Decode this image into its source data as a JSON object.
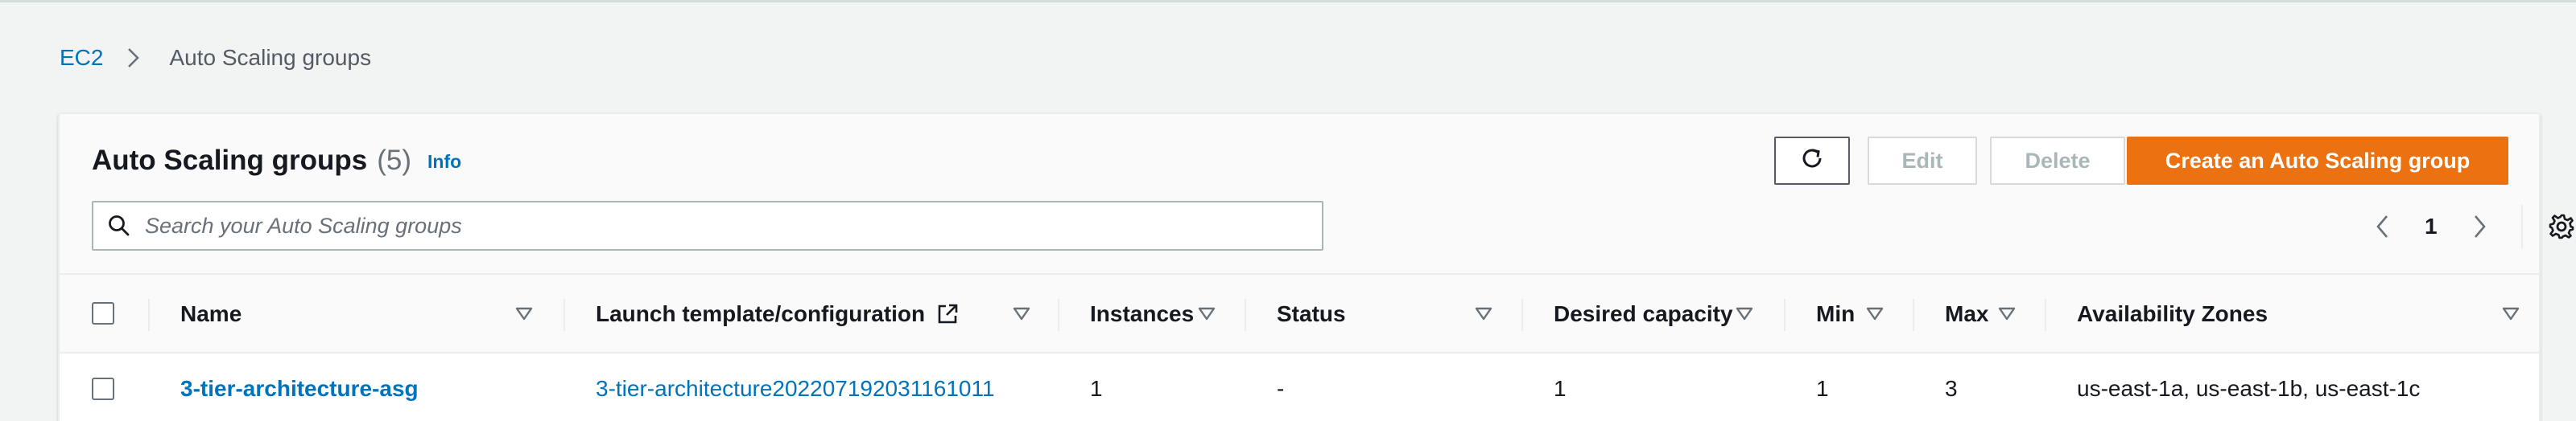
{
  "breadcrumb": {
    "root": "EC2",
    "current": "Auto Scaling groups"
  },
  "header": {
    "title": "Auto Scaling groups",
    "count": "(5)",
    "info": "Info"
  },
  "actions": {
    "refresh_icon": "refresh-icon",
    "edit": "Edit",
    "delete": "Delete",
    "create": "Create an Auto Scaling group"
  },
  "search": {
    "placeholder": "Search your Auto Scaling groups",
    "value": ""
  },
  "pagination": {
    "current_page": "1"
  },
  "table": {
    "columns": [
      "Name",
      "Launch template/configuration",
      "Instances",
      "Status",
      "Desired capacity",
      "Min",
      "Max",
      "Availability Zones"
    ],
    "rows": [
      {
        "name": "3-tier-architecture-asg",
        "launch_template": "3-tier-architecture20220719203116​1011",
        "instances": "1",
        "status": "-",
        "desired_capacity": "1",
        "min": "1",
        "max": "3",
        "availability_zones": "us-east-1a, us-east-1b, us-east-1c"
      }
    ]
  },
  "colors": {
    "link": "#0073bb",
    "primary_button": "#ec7211",
    "disabled_text": "#aab7b8"
  }
}
